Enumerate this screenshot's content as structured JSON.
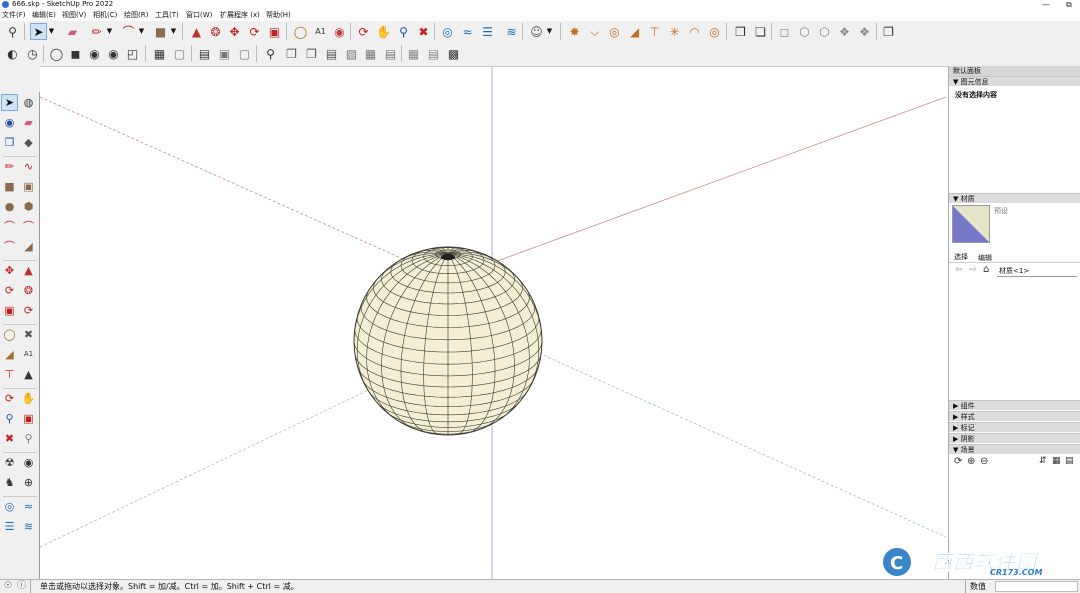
{
  "window": {
    "title": "666.skp - SketchUp Pro 2022",
    "minimize_glyph": "—",
    "restore_glyph": "⧉"
  },
  "menu": {
    "items": [
      "文件(F)",
      "编辑(E)",
      "视图(V)",
      "相机(C)",
      "绘图(R)",
      "工具(T)",
      "窗口(W)",
      "扩展程序 (x)",
      "帮助(H)"
    ]
  },
  "toolbar_icons": {
    "row1": [
      "search-icon",
      "select-arrow-icon",
      "dropdown-arrow-icon",
      "eraser-icon",
      "pencil-icon",
      "dropdown-arrow-icon",
      "arc-icon",
      "dropdown-arrow-icon",
      "rectangle-icon",
      "dropdown-arrow-icon",
      "push-pull-icon",
      "follow-me-icon",
      "move-icon",
      "rotate-icon",
      "scale-icon",
      "tape-measure-icon",
      "text-icon",
      "paint-bucket-icon",
      "orbit-icon",
      "pan-icon",
      "zoom-icon",
      "zoom-extents-icon",
      "3d-warehouse-icon",
      "extension-warehouse-icon",
      "layout-icon",
      "user-account-icon",
      "dropdown-arrow-icon",
      "geo-location-icon",
      "section-plane-icon",
      "circle-icon",
      "protractor-icon",
      "axes-icon",
      "star-icon",
      "dome-icon",
      "sphere-outline-icon",
      "component-icon",
      "group-icon",
      "iso-view-icon",
      "top-view-icon",
      "front-view-icon",
      "right-view-icon",
      "back-view-icon",
      "outliner-icon"
    ],
    "row2": [
      "xray-icon",
      "back-edges-icon",
      "wireframe-icon",
      "hidden-line-icon",
      "shaded-icon",
      "shaded-textures-icon",
      "monochrome-icon",
      "section-cut-icon",
      "section-fill-icon",
      "display-section-icon",
      "camera-position-icon",
      "walk-icon",
      "look-around-icon",
      "position-camera-icon",
      "sandbox-from-contours-icon",
      "sandbox-scratch-icon",
      "smoove-icon",
      "stamp-icon",
      "drape-icon",
      "add-detail-icon",
      "flip-edge-icon",
      "solid-union-icon",
      "solid-subtract-icon",
      "solid-trim-icon"
    ],
    "left_tools": [
      "select-icon",
      "orbit-icon",
      "paint-bucket-icon",
      "eraser-icon",
      "make-component-icon",
      "tag-icon",
      "line-icon",
      "freehand-icon",
      "rectangle-icon",
      "rotated-rectangle-icon",
      "circle-icon",
      "polygon-icon",
      "arc-icon",
      "two-point-arc-icon",
      "three-point-arc-icon",
      "pie-icon",
      "move-icon",
      "push-pull-icon",
      "rotate-icon",
      "follow-me-icon",
      "scale-icon",
      "offset-icon",
      "tape-measure-icon",
      "dimension-icon",
      "protractor-icon",
      "text-icon",
      "axes-icon",
      "3d-text-icon",
      "orbit-icon",
      "pan-icon",
      "zoom-icon",
      "zoom-window-icon",
      "zoom-extents-icon",
      "previous-view-icon",
      "position-camera-icon",
      "look-around-icon",
      "walk-icon",
      "section-plane-icon",
      "3d-warehouse-icon",
      "extension-warehouse-icon",
      "layout-icon",
      "extension-manager-icon"
    ]
  },
  "tray": {
    "title": "默认面板",
    "entity_info": {
      "header": "▼ 图元信息",
      "status": "没有选择内容"
    },
    "materials": {
      "header": "▼ 材质",
      "preset_label": "预设",
      "tabs": [
        "选择",
        "编辑"
      ],
      "current_material": "材质<1>"
    },
    "collapsed_panels": [
      "▶ 组件",
      "▶ 样式",
      "▶ 标记",
      "▶ 阴影"
    ],
    "scenes": {
      "header": "▼ 场景"
    }
  },
  "colors": {
    "sphere_fill": "#f2efd4",
    "sphere_mesh": "#3a3a30",
    "axis_red": "#b8585a",
    "axis_green": "#6aa06a",
    "axis_blue": "#6a78c8",
    "material_swatch_top": "#e6e4c8",
    "material_swatch_bottom": "#7878c8"
  },
  "status": {
    "message": "单击或拖动以选择对象。Shift = 加/减。Ctrl = 加。Shift + Ctrl = 减。",
    "measurements_label": "数值"
  },
  "watermark": {
    "brand": "西西软件园",
    "url": "CR173.COM"
  }
}
